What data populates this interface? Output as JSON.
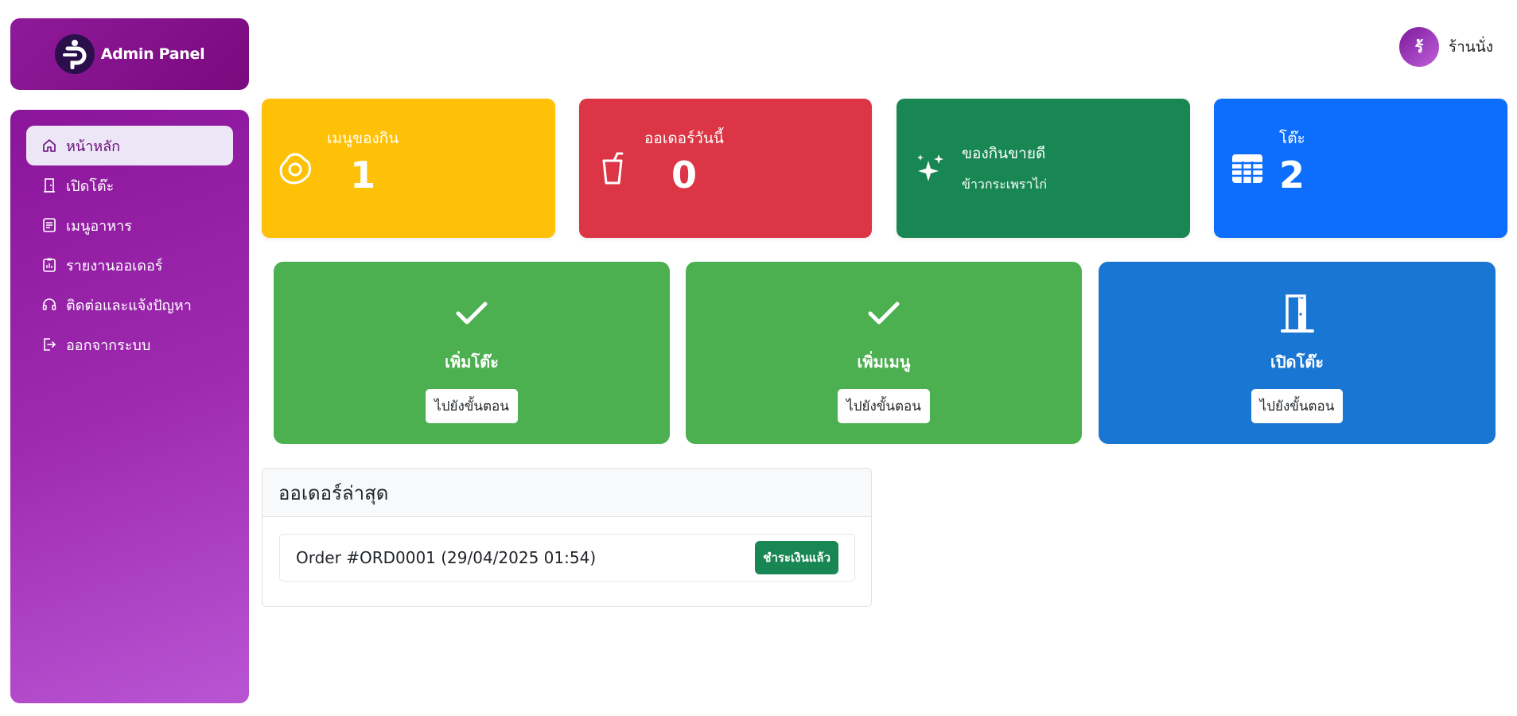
{
  "brand": {
    "title": "Admin Panel"
  },
  "sidebar": {
    "items": [
      {
        "label": "หน้าหลัก",
        "icon": "home-icon",
        "active": true
      },
      {
        "label": "เปิดโต๊ะ",
        "icon": "door-icon"
      },
      {
        "label": "เมนูอาหาร",
        "icon": "menu-list-icon"
      },
      {
        "label": "รายงานออเดอร์",
        "icon": "clipboard-icon"
      },
      {
        "label": "ติดต่อและแจ้งปัญหา",
        "icon": "headset-icon"
      },
      {
        "label": "ออกจากระบบ",
        "icon": "logout-icon"
      }
    ]
  },
  "user": {
    "avatar_letter": "ร้",
    "name": "ร้านนั่ง"
  },
  "stats": [
    {
      "label": "เมนูของกิน",
      "value": "1",
      "icon": "egg-icon",
      "color": "#ffc107"
    },
    {
      "label": "ออเดอร์วันนี้",
      "value": "0",
      "icon": "cup-icon",
      "color": "#dc3545"
    },
    {
      "label": "ของกินขายดี",
      "value": "ข้าวกระเพราไก่",
      "icon": "sparkles-icon",
      "color": "#198754"
    },
    {
      "label": "โต๊ะ",
      "value": "2",
      "icon": "table-icon",
      "color": "#0d6efd"
    }
  ],
  "actions": [
    {
      "title": "เพิ่มโต๊ะ",
      "button": "ไปยังขั้นตอน",
      "icon": "check-icon",
      "color": "#4caf50"
    },
    {
      "title": "เพิ่มเมนู",
      "button": "ไปยังขั้นตอน",
      "icon": "check-icon",
      "color": "#4caf50"
    },
    {
      "title": "เปิดโต๊ะ",
      "button": "ไปยังขั้นตอน",
      "icon": "door-open-icon",
      "color": "#1976d2"
    }
  ],
  "orders": {
    "title": "ออเดอร์ล่าสุด",
    "rows": [
      {
        "text": "Order #ORD0001 (29/04/2025 01:54)",
        "status": "ชำระเงินแล้ว"
      }
    ]
  }
}
